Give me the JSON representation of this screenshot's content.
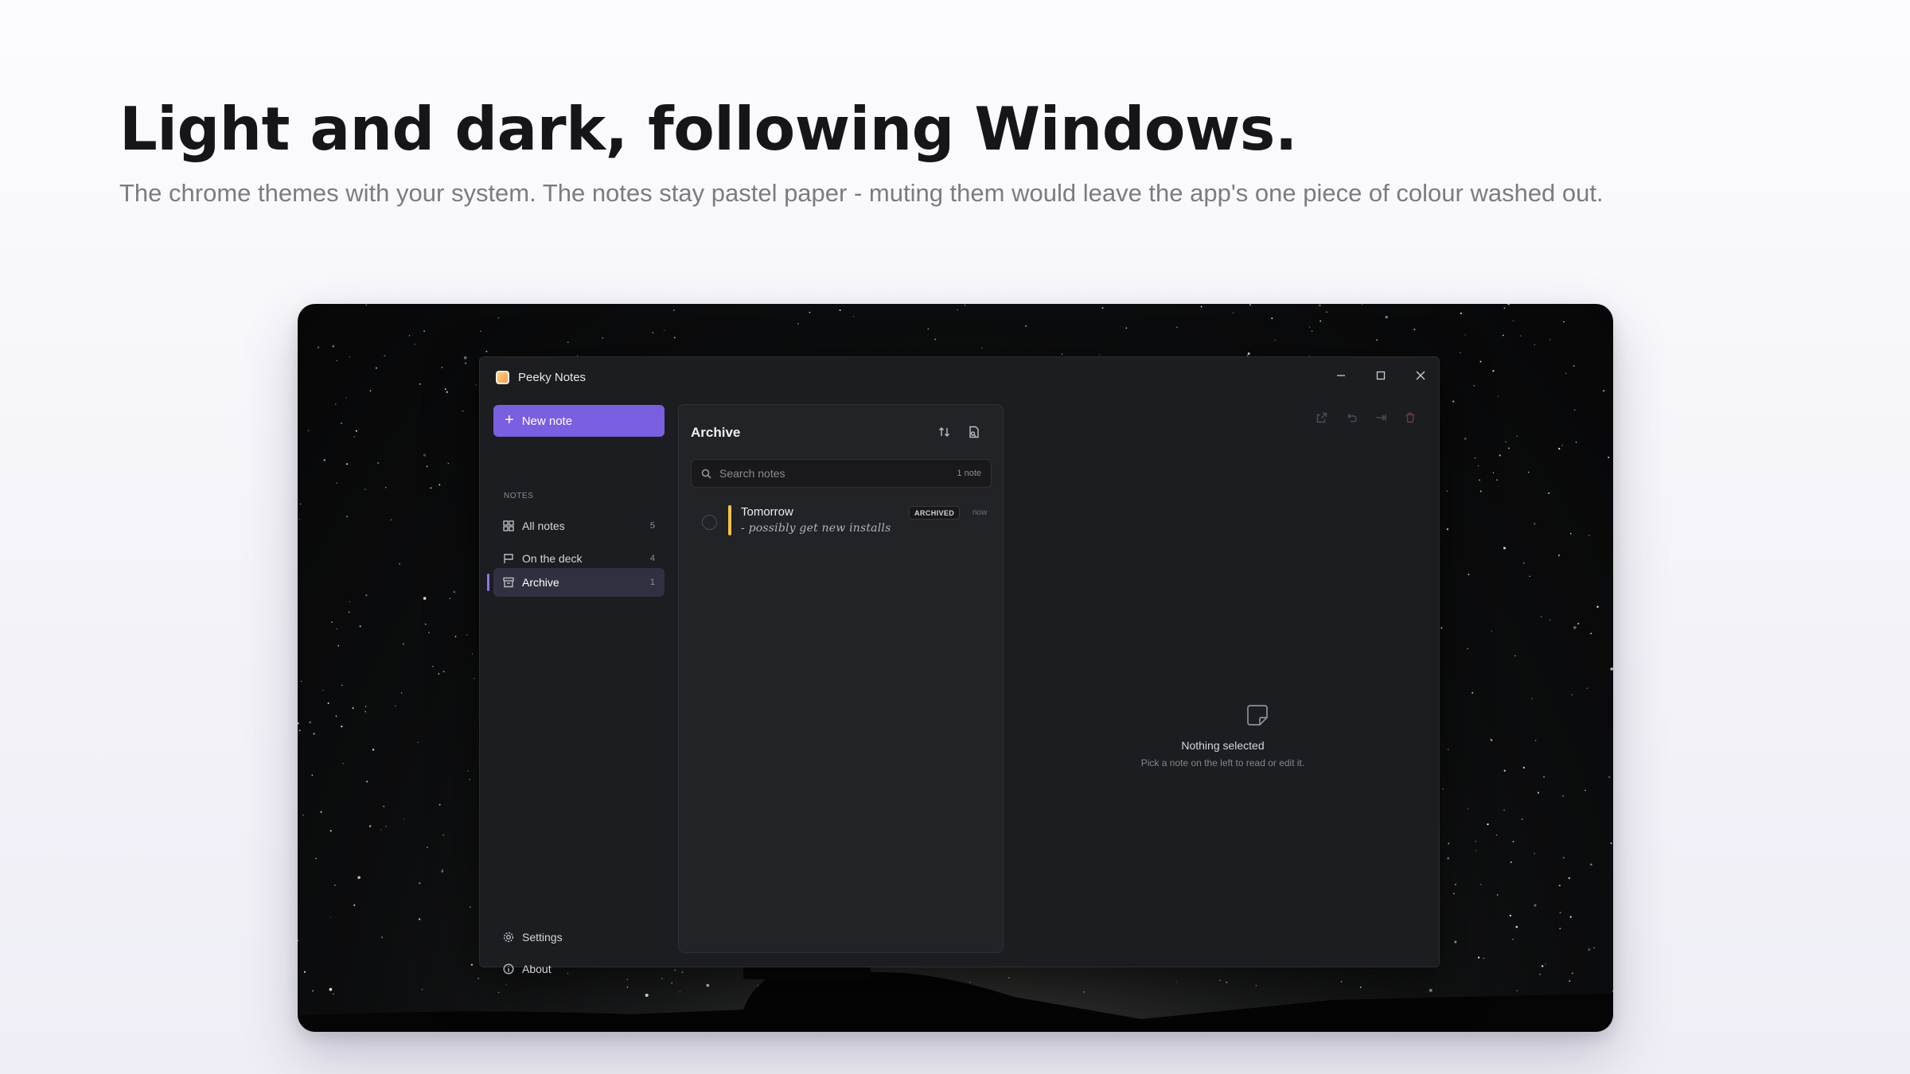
{
  "hero": {
    "title": "Light and dark, following Windows.",
    "subtitle": "The chrome themes with your system. The notes stay pastel paper - muting them would leave the app's one piece of colour washed out."
  },
  "window": {
    "title": "Peeky Notes",
    "icon": "app-icon",
    "controls": [
      "minimize-icon",
      "maximize-icon",
      "close-icon"
    ]
  },
  "sidebar": {
    "new_note_label": "New note",
    "section_label": "NOTES",
    "items": [
      {
        "label": "All notes",
        "count": "5",
        "icon": "grid-icon",
        "active": false
      },
      {
        "label": "On the deck",
        "count": "4",
        "icon": "flag-icon",
        "active": false
      },
      {
        "label": "Archive",
        "count": "1",
        "icon": "archive-icon",
        "active": true
      }
    ],
    "footer": [
      {
        "label": "Settings",
        "icon": "gear-icon"
      },
      {
        "label": "About",
        "icon": "info-icon"
      }
    ]
  },
  "list": {
    "title": "Archive",
    "search_placeholder": "Search notes",
    "note_count": "1 note",
    "notes": [
      {
        "title": "Tomorrow",
        "preview": "- possibly get new installs",
        "badge": "ARCHIVED",
        "time": "now",
        "color": "#f3c24b"
      }
    ]
  },
  "detail": {
    "empty_title": "Nothing selected",
    "empty_subtitle": "Pick a note on the left to read or edit it."
  },
  "colors": {
    "accent": "#7a5fe0",
    "note_yellow": "#f3c24b",
    "window_bg": "#1c1d20"
  }
}
